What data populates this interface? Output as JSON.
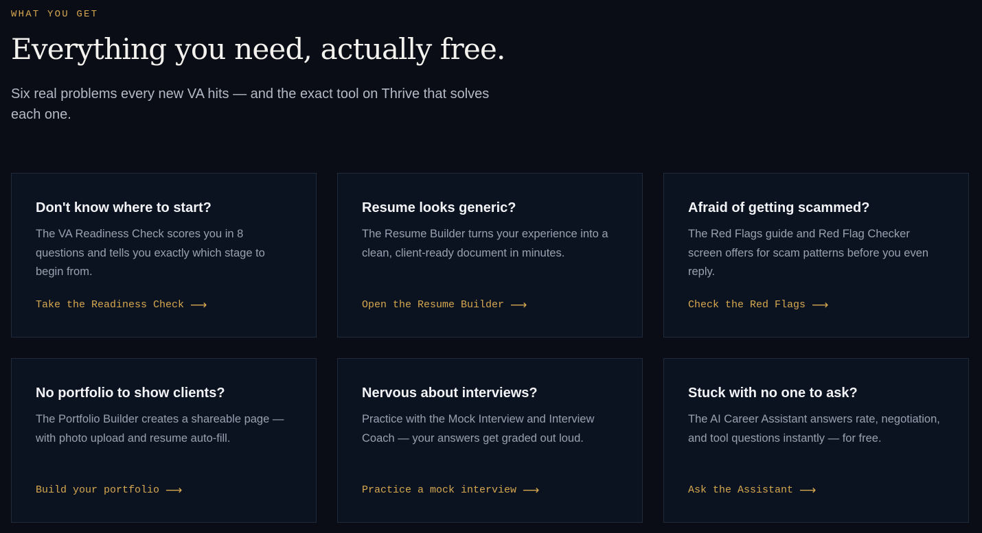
{
  "section": {
    "eyebrow": "WHAT YOU GET",
    "title": "Everything you need, actually free.",
    "subtitle": "Six real problems every new VA hits — and the exact tool on Thrive that solves each one."
  },
  "cards": [
    {
      "title": "Don't know where to start?",
      "body": "The VA Readiness Check scores you in 8 questions and tells you exactly which stage to begin from.",
      "link": "Take the Readiness Check",
      "arrow": "⟶"
    },
    {
      "title": "Resume looks generic?",
      "body": "The Resume Builder turns your experience into a clean, client-ready document in minutes.",
      "link": "Open the Resume Builder",
      "arrow": "⟶"
    },
    {
      "title": "Afraid of getting scammed?",
      "body": "The Red Flags guide and Red Flag Checker screen offers for scam patterns before you even reply.",
      "link": "Check the Red Flags",
      "arrow": "⟶"
    },
    {
      "title": "No portfolio to show clients?",
      "body": "The Portfolio Builder creates a shareable page — with photo upload and resume auto-fill.",
      "link": "Build your portfolio",
      "arrow": "⟶"
    },
    {
      "title": "Nervous about interviews?",
      "body": "Practice with the Mock Interview and Interview Coach — your answers get graded out loud.",
      "link": "Practice a mock interview",
      "arrow": "⟶"
    },
    {
      "title": "Stuck with no one to ask?",
      "body": "The AI Career Assistant answers rate, negotiation, and tool questions instantly — for free.",
      "link": "Ask the Assistant",
      "arrow": "⟶"
    }
  ],
  "colors": {
    "background": "#0a0d16",
    "card_background": "#0c1320",
    "card_border": "#1f2a3a",
    "accent": "#d6a84f",
    "heading": "#f4f2ee",
    "body_text": "#99a1b0"
  },
  "icons": {
    "link_arrow": "arrow-right-icon"
  }
}
